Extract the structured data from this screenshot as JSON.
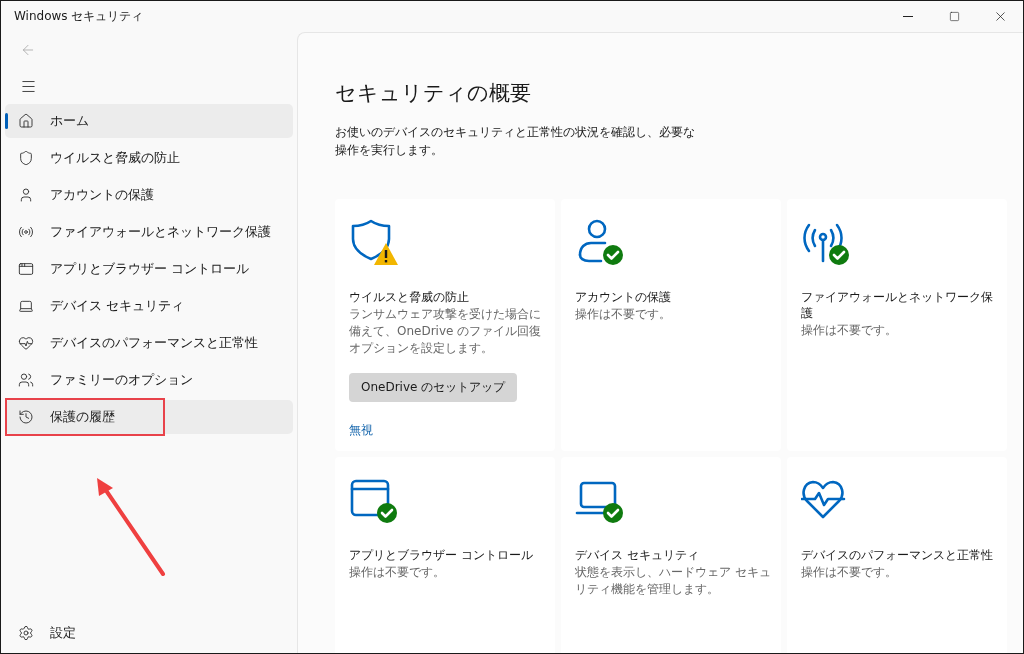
{
  "window": {
    "title": "Windows セキュリティ"
  },
  "sidebar": {
    "items": [
      {
        "label": "ホーム",
        "selected": true,
        "hovered": false,
        "annotated": false
      },
      {
        "label": "ウイルスと脅威の防止",
        "selected": false,
        "hovered": false,
        "annotated": false
      },
      {
        "label": "アカウントの保護",
        "selected": false,
        "hovered": false,
        "annotated": false
      },
      {
        "label": "ファイアウォールとネットワーク保護",
        "selected": false,
        "hovered": false,
        "annotated": false
      },
      {
        "label": "アプリとブラウザー コントロール",
        "selected": false,
        "hovered": false,
        "annotated": false
      },
      {
        "label": "デバイス セキュリティ",
        "selected": false,
        "hovered": false,
        "annotated": false
      },
      {
        "label": "デバイスのパフォーマンスと正常性",
        "selected": false,
        "hovered": false,
        "annotated": false
      },
      {
        "label": "ファミリーのオプション",
        "selected": false,
        "hovered": false,
        "annotated": false
      },
      {
        "label": "保護の履歴",
        "selected": false,
        "hovered": true,
        "annotated": true
      }
    ],
    "settings": {
      "label": "設定"
    }
  },
  "main": {
    "title": "セキュリティの概要",
    "description": "お使いのデバイスのセキュリティと正常性の状況を確認し、必要な操作を実行します。",
    "cards": [
      {
        "kind": "warning",
        "title": "ウイルスと脅威の防止",
        "description": "ランサムウェア攻撃を受けた場合に備えて、OneDrive のファイル回復オプションを設定します。",
        "button": "OneDrive のセットアップ",
        "link": "無視"
      },
      {
        "kind": "ok",
        "title": "アカウントの保護",
        "description": "操作は不要です。"
      },
      {
        "kind": "ok",
        "title": "ファイアウォールとネットワーク保護",
        "description": "操作は不要です。"
      },
      {
        "kind": "ok",
        "title": "アプリとブラウザー コントロール",
        "description": "操作は不要です。"
      },
      {
        "kind": "ok",
        "title": "デバイス セキュリティ",
        "description": "状態を表示し、ハードウェア セキュリティ機能を管理します。"
      },
      {
        "kind": "plain",
        "title": "デバイスのパフォーマンスと正常性",
        "description": "操作は不要です。"
      }
    ]
  }
}
